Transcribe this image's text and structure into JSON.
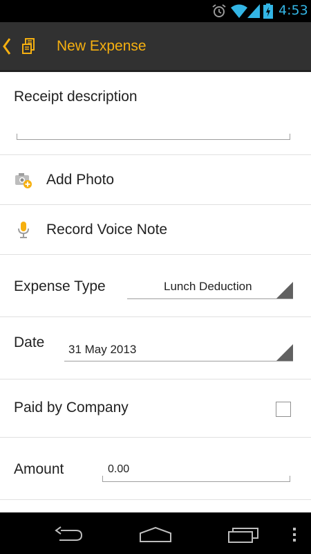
{
  "status_bar": {
    "time": "4:53",
    "icons": [
      "alarm-icon",
      "wifi-icon",
      "signal-icon",
      "battery-icon"
    ],
    "accent_color": "#33b5e5"
  },
  "action_bar": {
    "title": "New Expense",
    "title_color": "#f6b010",
    "background": "#313131",
    "icons": [
      "back-chevron-icon",
      "receipt-icon"
    ]
  },
  "form": {
    "receipt_description": {
      "label": "Receipt description",
      "value": ""
    },
    "add_photo": {
      "label": "Add Photo",
      "icon": "camera-add-icon"
    },
    "record_voice": {
      "label": "Record Voice Note",
      "icon": "microphone-icon"
    },
    "expense_type": {
      "label": "Expense Type",
      "value": "Lunch Deduction"
    },
    "date": {
      "label": "Date",
      "value": "31 May 2013"
    },
    "paid_by_company": {
      "label": "Paid by Company",
      "checked": false
    },
    "amount": {
      "label": "Amount",
      "value": "0.00"
    }
  },
  "nav_bar": {
    "buttons": [
      "back-nav-icon",
      "home-nav-icon",
      "recents-nav-icon",
      "overflow-menu-icon"
    ]
  }
}
